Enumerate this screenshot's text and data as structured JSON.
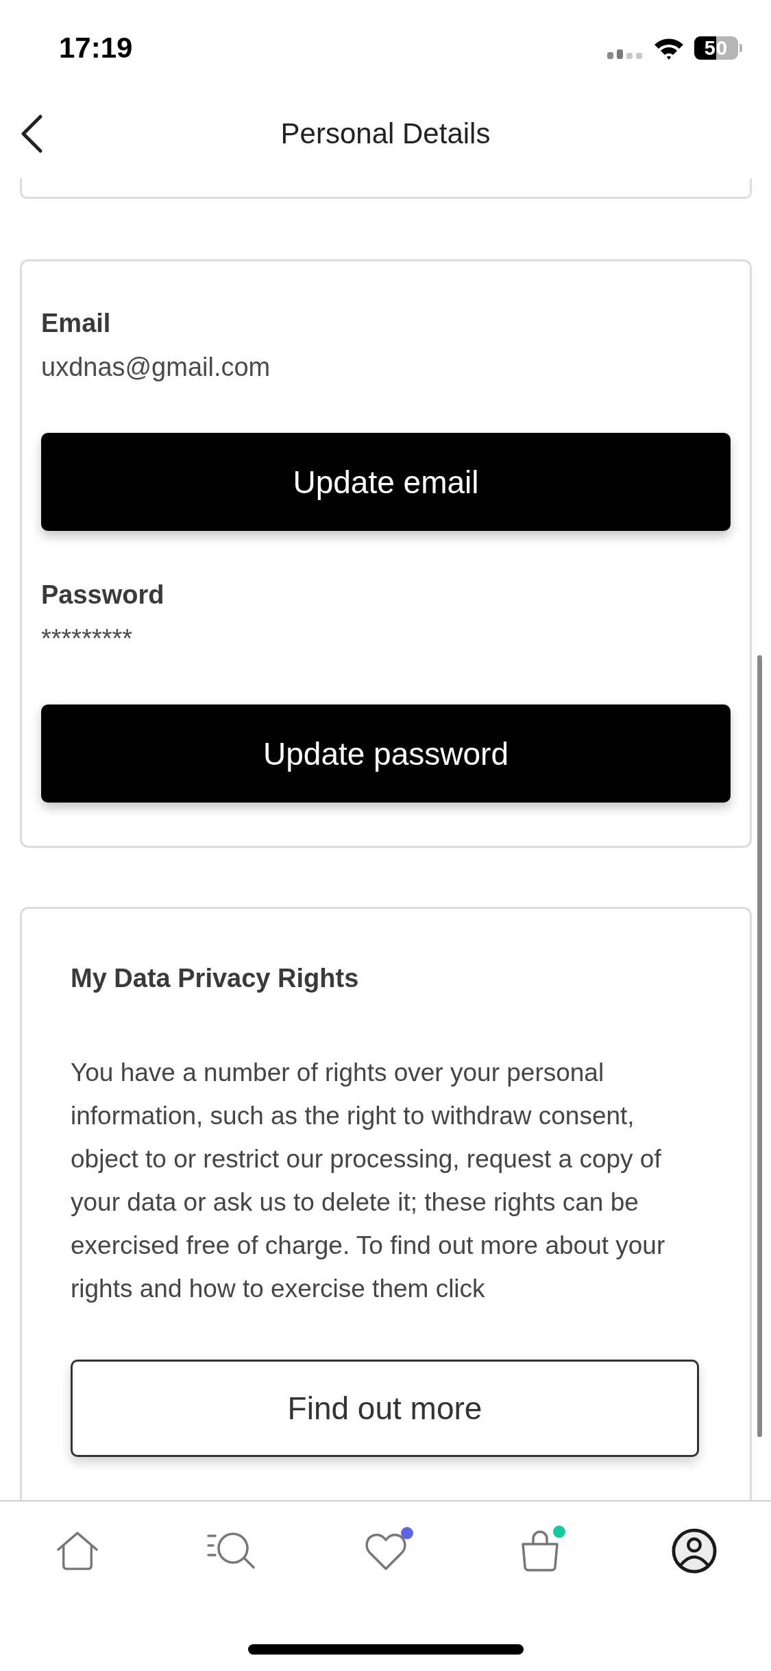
{
  "status_bar": {
    "time": "17:19",
    "battery": "50"
  },
  "header": {
    "title": "Personal Details"
  },
  "account_card": {
    "fields": [
      {
        "label": "Email",
        "value": "uxdnas@gmail.com",
        "button": "Update email"
      },
      {
        "label": "Password",
        "value": "*********",
        "button": "Update password"
      }
    ]
  },
  "privacy_card": {
    "title": "My Data Privacy Rights",
    "body": "You have a number of rights over your personal information, such as the right to withdraw consent, object to or restrict our processing, request a copy of your data or ask us to delete it; these rights can be exercised free of charge. To find out more about your rights and how to exercise them click",
    "button": "Find out more"
  },
  "tab_bar": {
    "tabs": [
      {
        "kind": "home",
        "selected": false
      },
      {
        "kind": "search",
        "selected": false
      },
      {
        "kind": "wishlist",
        "selected": false,
        "color": "#5a67e0"
      },
      {
        "kind": "bag",
        "selected": false,
        "color": "#14c8a0"
      },
      {
        "kind": "profile",
        "selected": true
      }
    ]
  }
}
